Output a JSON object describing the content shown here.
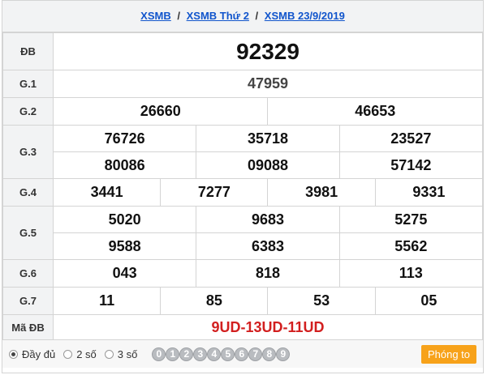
{
  "breadcrumb": {
    "items": [
      "XSMB",
      "XSMB Thứ 2",
      "XSMB 23/9/2019"
    ],
    "separator": "/"
  },
  "results": {
    "db": {
      "label": "ĐB",
      "value": "92329"
    },
    "g1": {
      "label": "G.1",
      "value": "47959"
    },
    "g2": {
      "label": "G.2",
      "values": [
        "26660",
        "46653"
      ]
    },
    "g3": {
      "label": "G.3",
      "values": [
        "76726",
        "35718",
        "23527",
        "80086",
        "09088",
        "57142"
      ]
    },
    "g4": {
      "label": "G.4",
      "values": [
        "3441",
        "7277",
        "3981",
        "9331"
      ]
    },
    "g5": {
      "label": "G.5",
      "values": [
        "5020",
        "9683",
        "5275",
        "9588",
        "6383",
        "5562"
      ]
    },
    "g6": {
      "label": "G.6",
      "values": [
        "043",
        "818",
        "113"
      ]
    },
    "g7": {
      "label": "G.7",
      "values": [
        "11",
        "85",
        "53",
        "05"
      ]
    },
    "madb": {
      "label": "Mã ĐB",
      "value": "9UD-13UD-11UD"
    }
  },
  "footer": {
    "options": [
      {
        "label": "Đầy đủ",
        "selected": true
      },
      {
        "label": "2 số",
        "selected": false
      },
      {
        "label": "3 số",
        "selected": false
      }
    ],
    "digits": [
      "0",
      "1",
      "2",
      "3",
      "4",
      "5",
      "6",
      "7",
      "8",
      "9"
    ],
    "zoom_button": "Phóng to"
  },
  "colors": {
    "special_prize": "#d21f1f",
    "link": "#1155cc",
    "button": "#f7a21a",
    "label_bg": "#f2f3f4"
  }
}
